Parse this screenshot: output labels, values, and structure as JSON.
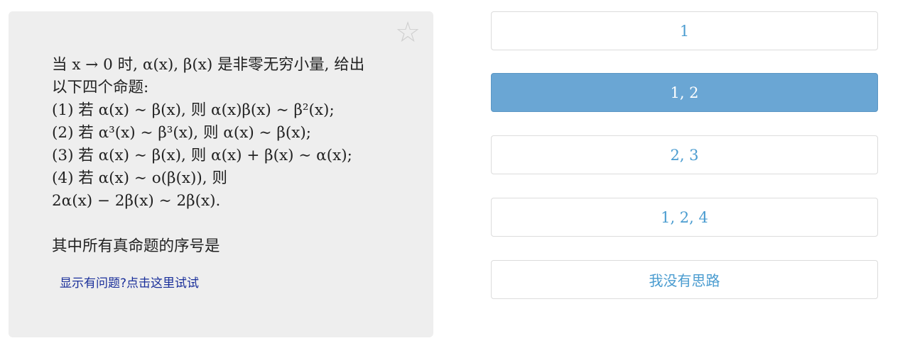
{
  "question": {
    "favorite_icon": "star-outline-icon",
    "lines": [
      "当 x → 0 时, α(x), β(x) 是非零无穷小量, 给出",
      "以下四个命题:",
      "(1) 若 α(x) ∼ β(x), 则 α(x)β(x) ∼ β²(x);",
      "(2) 若 α³(x) ∼ β³(x), 则 α(x) ∼ β(x);",
      "(3) 若 α(x) ∼ β(x), 则 α(x) + β(x) ∼ α(x);",
      "(4) 若 α(x) ∼ o(β(x)), 则",
      "2α(x) − 2β(x) ∼ 2β(x)."
    ],
    "prompt": "其中所有真命题的序号是",
    "help_link": "显示有问题?点击这里试试"
  },
  "options": [
    {
      "label": "1",
      "selected": false
    },
    {
      "label": "1, 2",
      "selected": true
    },
    {
      "label": "2, 3",
      "selected": false
    },
    {
      "label": "1, 2, 4",
      "selected": false
    },
    {
      "label": "我没有思路",
      "selected": false
    }
  ],
  "colors": {
    "card_bg": "#eeeeee",
    "option_text": "#4a9cd0",
    "selected_bg": "#6aa6d4",
    "link": "#1a2f9a"
  }
}
